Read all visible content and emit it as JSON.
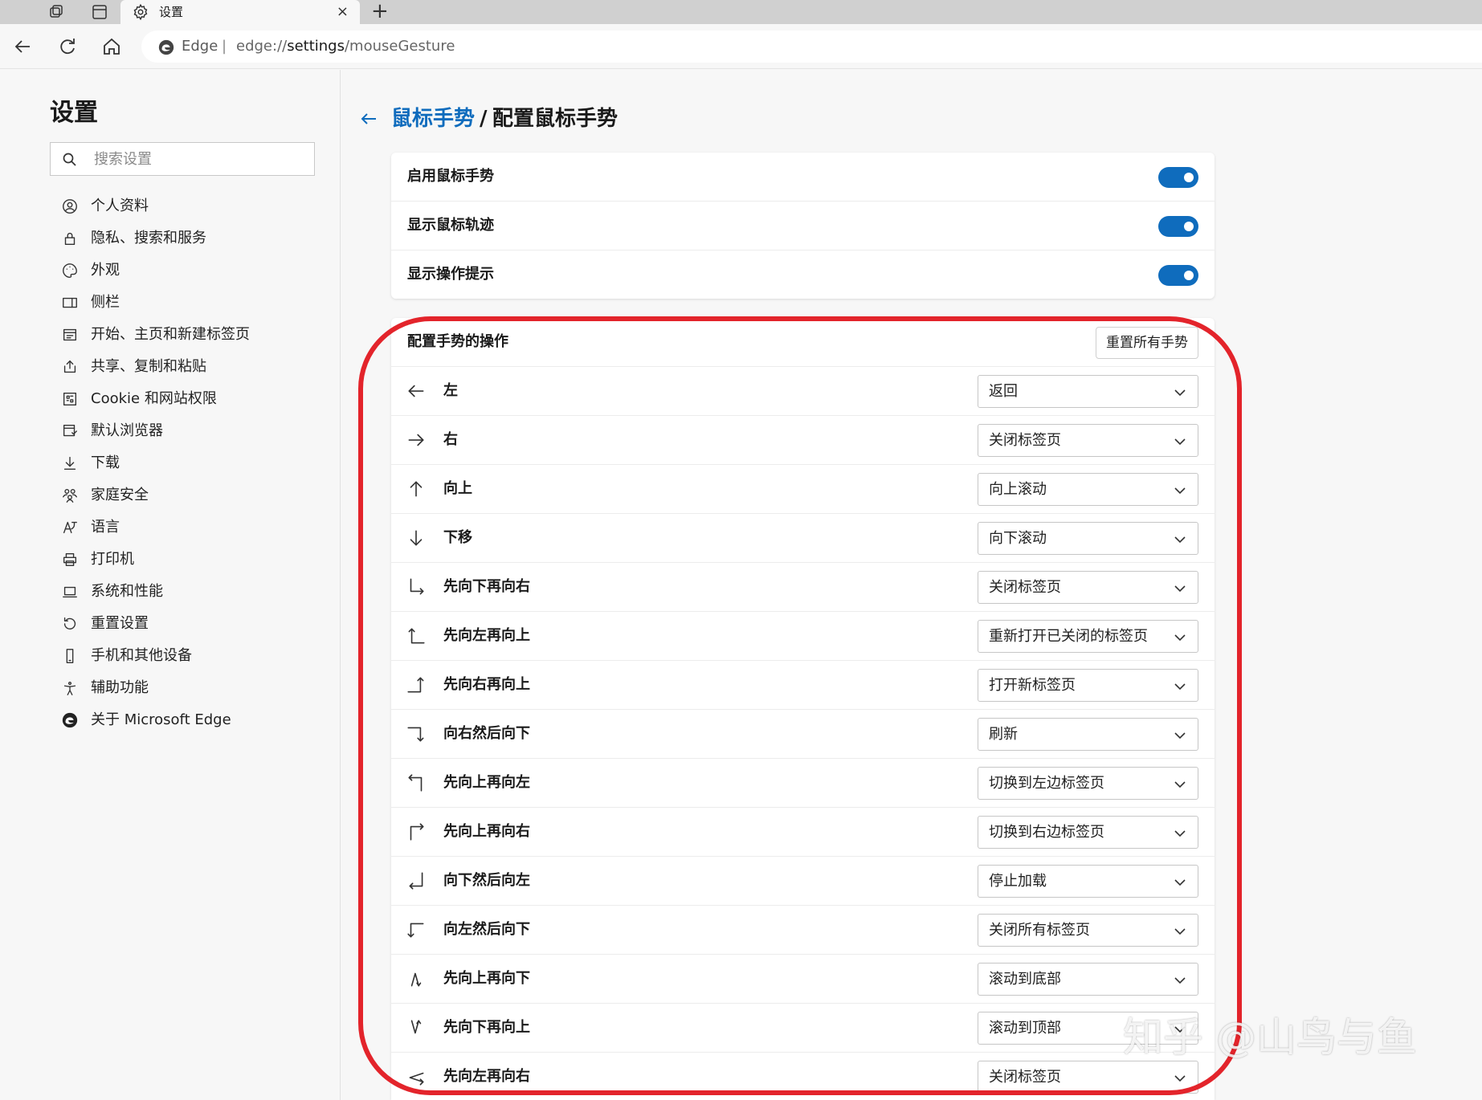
{
  "browser": {
    "tab_title": "设置",
    "new_tab_symbol": "+",
    "close_symbol": "×",
    "brand": "Edge",
    "separator": "|",
    "url_prefix": "edge://",
    "url_bold": "settings",
    "url_suffix": "/mouseGesture"
  },
  "sidebar": {
    "title": "设置",
    "search_placeholder": "搜索设置",
    "items": [
      {
        "label": "个人资料",
        "icon": "profile-icon"
      },
      {
        "label": "隐私、搜索和服务",
        "icon": "lock-icon"
      },
      {
        "label": "外观",
        "icon": "palette-icon"
      },
      {
        "label": "侧栏",
        "icon": "sidebar-icon"
      },
      {
        "label": "开始、主页和新建标签页",
        "icon": "home-tab-icon"
      },
      {
        "label": "共享、复制和粘贴",
        "icon": "share-icon"
      },
      {
        "label": "Cookie 和网站权限",
        "icon": "cookie-icon"
      },
      {
        "label": "默认浏览器",
        "icon": "default-browser-icon"
      },
      {
        "label": "下载",
        "icon": "download-icon"
      },
      {
        "label": "家庭安全",
        "icon": "family-icon"
      },
      {
        "label": "语言",
        "icon": "language-icon"
      },
      {
        "label": "打印机",
        "icon": "printer-icon"
      },
      {
        "label": "系统和性能",
        "icon": "laptop-icon"
      },
      {
        "label": "重置设置",
        "icon": "reset-icon"
      },
      {
        "label": "手机和其他设备",
        "icon": "phone-icon"
      },
      {
        "label": "辅助功能",
        "icon": "accessibility-icon"
      },
      {
        "label": "关于 Microsoft Edge",
        "icon": "edge-logo-icon"
      }
    ]
  },
  "breadcrumb": {
    "parent": "鼠标手势",
    "separator": "/",
    "current": "配置鼠标手势"
  },
  "toggles": [
    {
      "label": "启用鼠标手势",
      "on": true
    },
    {
      "label": "显示鼠标轨迹",
      "on": true
    },
    {
      "label": "显示操作提示",
      "on": true
    }
  ],
  "gestures": {
    "header": "配置手势的操作",
    "reset_label": "重置所有手势",
    "rows": [
      {
        "name": "左",
        "action": "返回",
        "icon": "arrow-left-icon"
      },
      {
        "name": "右",
        "action": "关闭标签页",
        "icon": "arrow-right-icon"
      },
      {
        "name": "向上",
        "action": "向上滚动",
        "icon": "arrow-up-icon"
      },
      {
        "name": "下移",
        "action": "向下滚动",
        "icon": "arrow-down-icon"
      },
      {
        "name": "先向下再向右",
        "action": "关闭标签页",
        "icon": "down-then-right-icon"
      },
      {
        "name": "先向左再向上",
        "action": "重新打开已关闭的标签页",
        "icon": "left-then-up-icon"
      },
      {
        "name": "先向右再向上",
        "action": "打开新标签页",
        "icon": "right-then-up-icon"
      },
      {
        "name": "向右然后向下",
        "action": "刷新",
        "icon": "right-then-down-icon"
      },
      {
        "name": "先向上再向左",
        "action": "切换到左边标签页",
        "icon": "up-then-left-icon"
      },
      {
        "name": "先向上再向右",
        "action": "切换到右边标签页",
        "icon": "up-then-right-icon"
      },
      {
        "name": "向下然后向左",
        "action": "停止加载",
        "icon": "down-then-left-icon"
      },
      {
        "name": "向左然后向下",
        "action": "关闭所有标签页",
        "icon": "left-then-down-icon"
      },
      {
        "name": "先向上再向下",
        "action": "滚动到底部",
        "icon": "up-then-down-icon"
      },
      {
        "name": "先向下再向上",
        "action": "滚动到顶部",
        "icon": "down-then-up-icon"
      },
      {
        "name": "先向左再向右",
        "action": "关闭标签页",
        "icon": "left-then-right-icon"
      }
    ]
  },
  "watermark": "知乎 @山鸟与鱼",
  "colors": {
    "accent": "#0f6cbd",
    "highlight": "#e3242b"
  }
}
